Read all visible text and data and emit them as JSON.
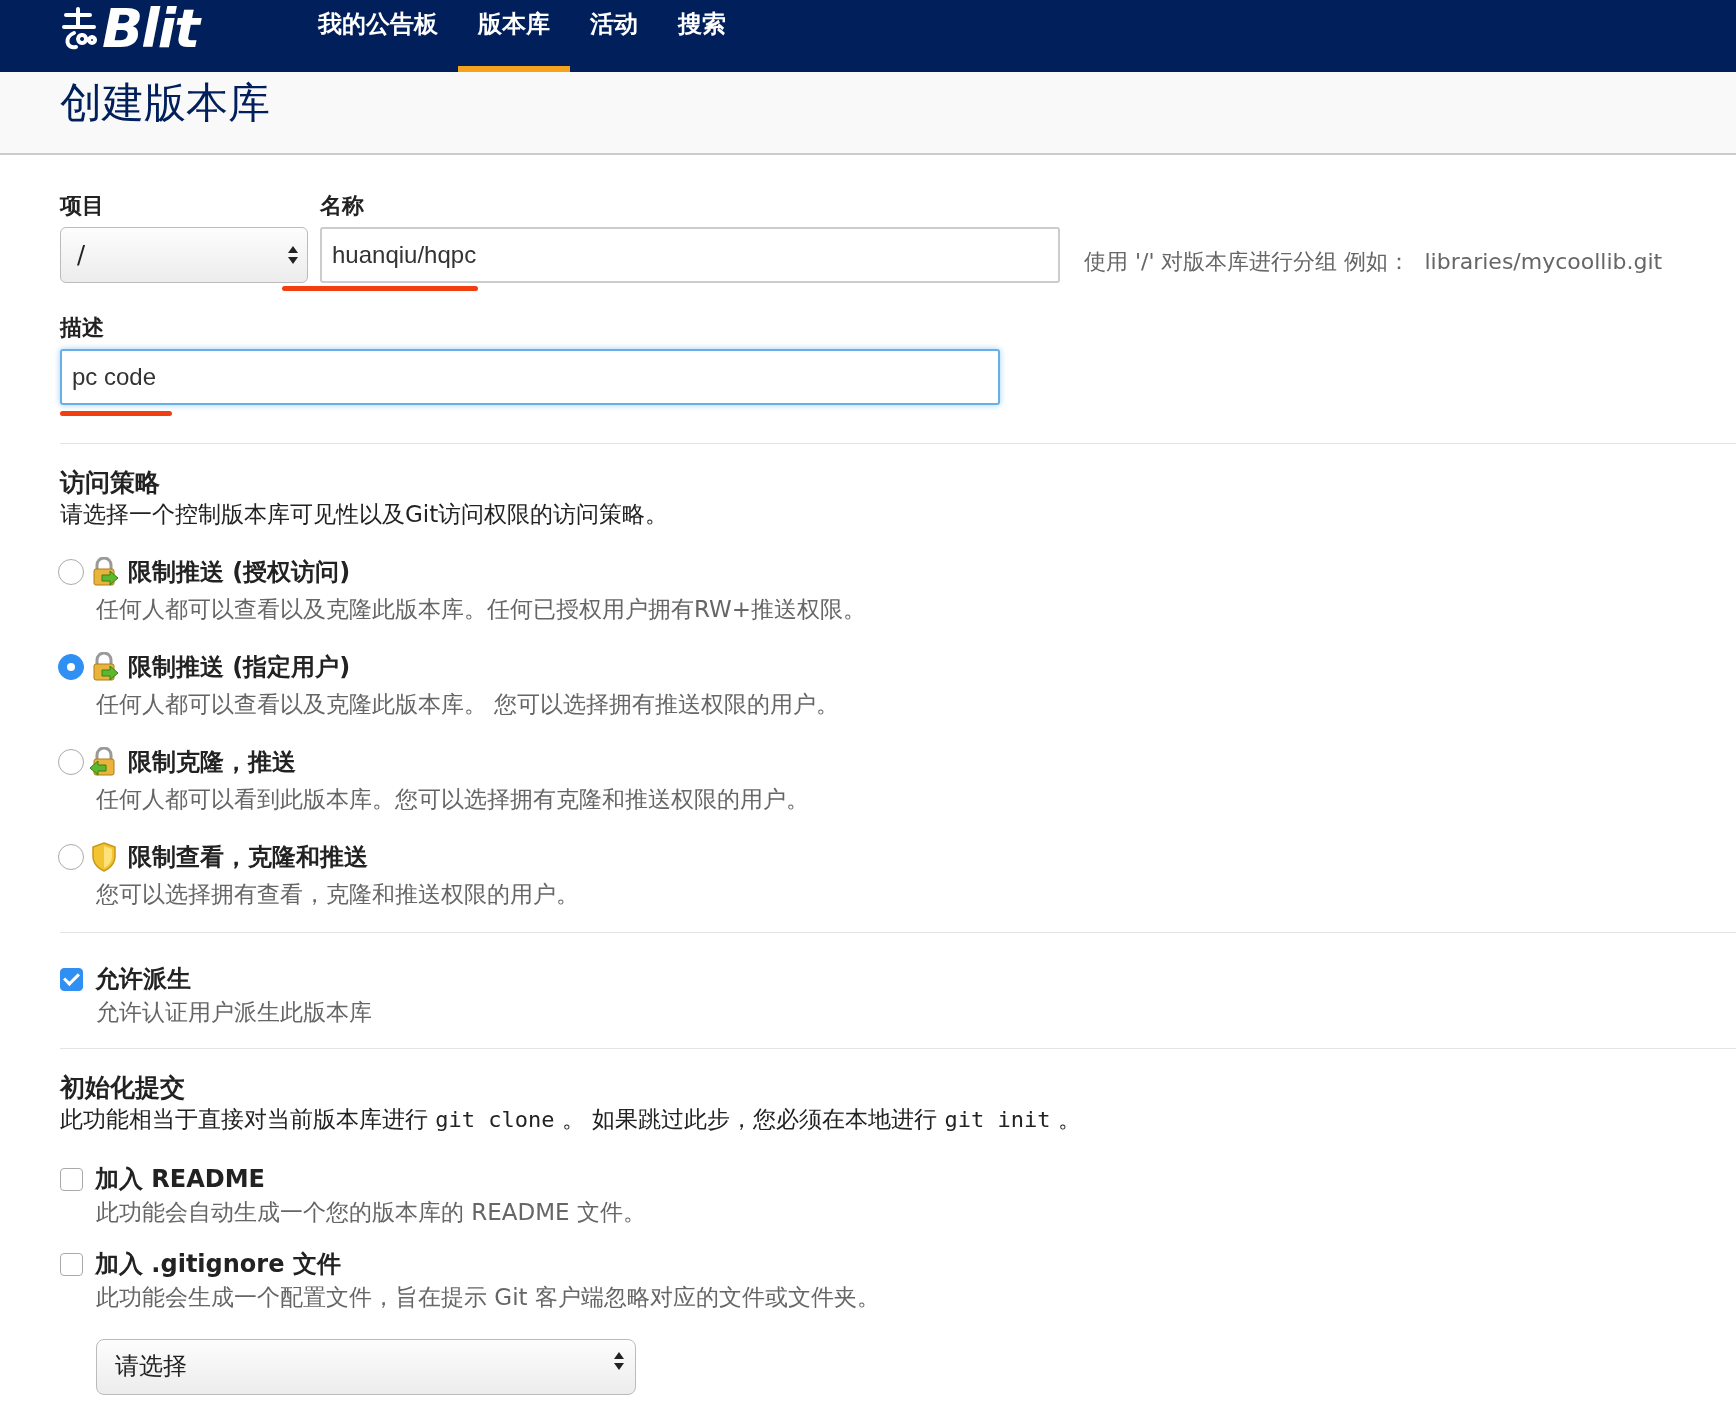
{
  "header": {
    "logo_text": "Blit",
    "nav": [
      {
        "label": "我的公告板",
        "selected": false
      },
      {
        "label": "版本库",
        "selected": true
      },
      {
        "label": "活动",
        "selected": false
      },
      {
        "label": "搜索",
        "selected": false
      }
    ]
  },
  "page_title": "创建版本库",
  "form": {
    "project": {
      "label": "项目",
      "value": "/"
    },
    "name": {
      "label": "名称",
      "value": "huanqiu/hqpc",
      "hint": "使用 '/' 对版本库进行分组 例如：",
      "example": "libraries/mycoollib.git"
    },
    "description": {
      "label": "描述",
      "value": "pc code",
      "focused": true
    },
    "access": {
      "title": "访问策略",
      "description": "请选择一个控制版本库可见性以及Git访问权限的访问策略。",
      "options": [
        {
          "kind": "push",
          "title": "限制推送 (授权访问)",
          "description": "任何人都可以查看以及克隆此版本库。任何已授权用户拥有RW+推送权限。",
          "selected": false
        },
        {
          "kind": "push",
          "title": "限制推送 (指定用户)",
          "description": "任何人都可以查看以及克隆此版本库。 您可以选择拥有推送权限的用户。",
          "selected": true
        },
        {
          "kind": "clone",
          "title": "限制克隆，推送",
          "description": "任何人都可以看到此版本库。您可以选择拥有克隆和推送权限的用户。",
          "selected": false
        },
        {
          "kind": "view",
          "title": "限制查看，克隆和推送",
          "description": "您可以选择拥有查看，克隆和推送权限的用户。",
          "selected": false
        }
      ]
    },
    "fork": {
      "label": "允许派生",
      "description": "允许认证用户派生此版本库",
      "checked": true
    },
    "init": {
      "title": "初始化提交",
      "description": [
        {
          "kind": "text",
          "text": "此功能相当于直接对当前版本库进行 "
        },
        {
          "kind": "code",
          "text": "git clone"
        },
        {
          "kind": "text",
          "text": " 。 如果跳过此步，您必须在本地进行 "
        },
        {
          "kind": "code",
          "text": "git init"
        },
        {
          "kind": "text",
          "text": " 。"
        }
      ],
      "options": [
        {
          "label": "加入 README",
          "description": "此功能会自动生成一个您的版本库的 README 文件。",
          "checked": false
        },
        {
          "label": "加入 .gitignore 文件",
          "description": "此功能会生成一个配置文件，旨在提示 Git 客户端忽略对应的文件或文件夹。",
          "checked": false
        }
      ],
      "gitignore_select": {
        "value": "请选择"
      }
    }
  }
}
